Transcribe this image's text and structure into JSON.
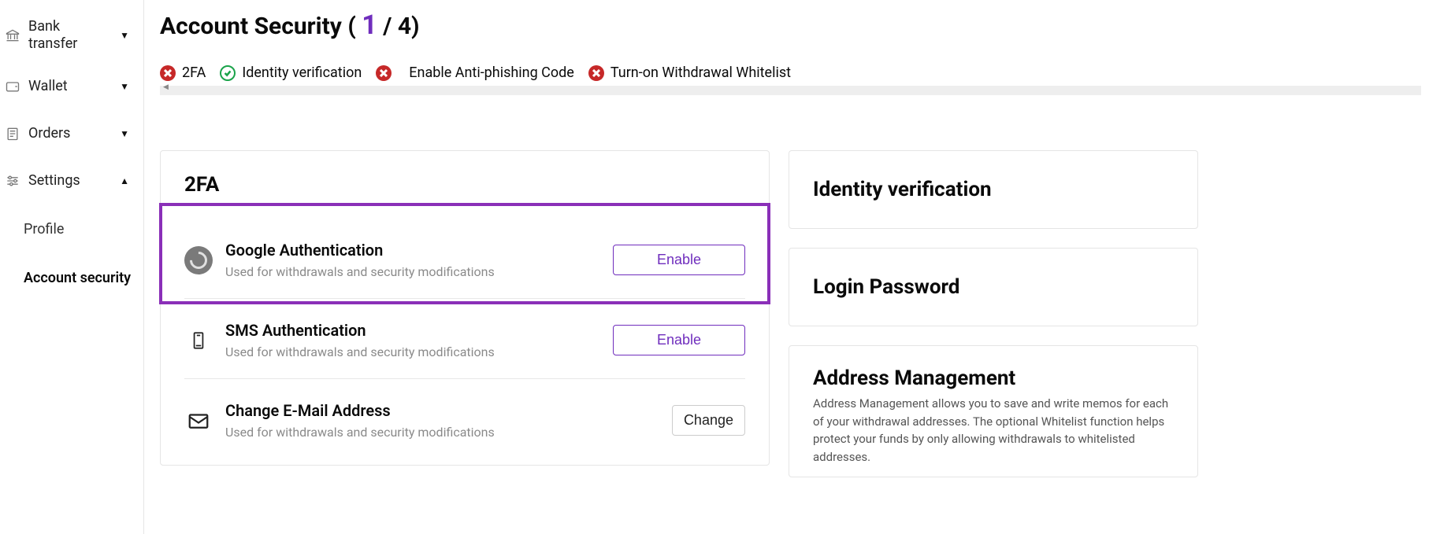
{
  "sidebar": {
    "items": [
      {
        "label": "Bank transfer",
        "chevron": "▼"
      },
      {
        "label": "Wallet",
        "chevron": "▼"
      },
      {
        "label": "Orders",
        "chevron": "▼"
      },
      {
        "label": "Settings",
        "chevron": "▲"
      }
    ],
    "sub": [
      {
        "label": "Profile"
      },
      {
        "label": "Account security"
      }
    ]
  },
  "header": {
    "title_prefix": "Account Security ( ",
    "count_current": "1",
    "count_suffix": " / 4)"
  },
  "status": [
    {
      "kind": "red",
      "label": "2FA"
    },
    {
      "kind": "green",
      "label": "Identity verification"
    },
    {
      "kind": "red",
      "label": "Enable Anti-phishing Code"
    },
    {
      "kind": "red",
      "label": "Turn-on Withdrawal Whitelist"
    }
  ],
  "twofa": {
    "title": "2FA",
    "rows": [
      {
        "title": "Google Authentication",
        "sub": "Used for withdrawals and security modifications",
        "action": "Enable",
        "action_style": "purple"
      },
      {
        "title": "SMS Authentication",
        "sub": "Used for withdrawals and security modifications",
        "action": "Enable",
        "action_style": "purple"
      },
      {
        "title": "Change E-Mail Address",
        "sub": "Used for withdrawals and security modifications",
        "action": "Change",
        "action_style": "light"
      }
    ]
  },
  "right": {
    "identity_title": "Identity verification",
    "login_title": "Login Password",
    "addr_title": "Address Management",
    "addr_desc": "Address Management allows you to save and write memos for each of your withdrawal addresses. The optional Whitelist function helps protect your funds by only allowing withdrawals to whitelisted addresses."
  }
}
